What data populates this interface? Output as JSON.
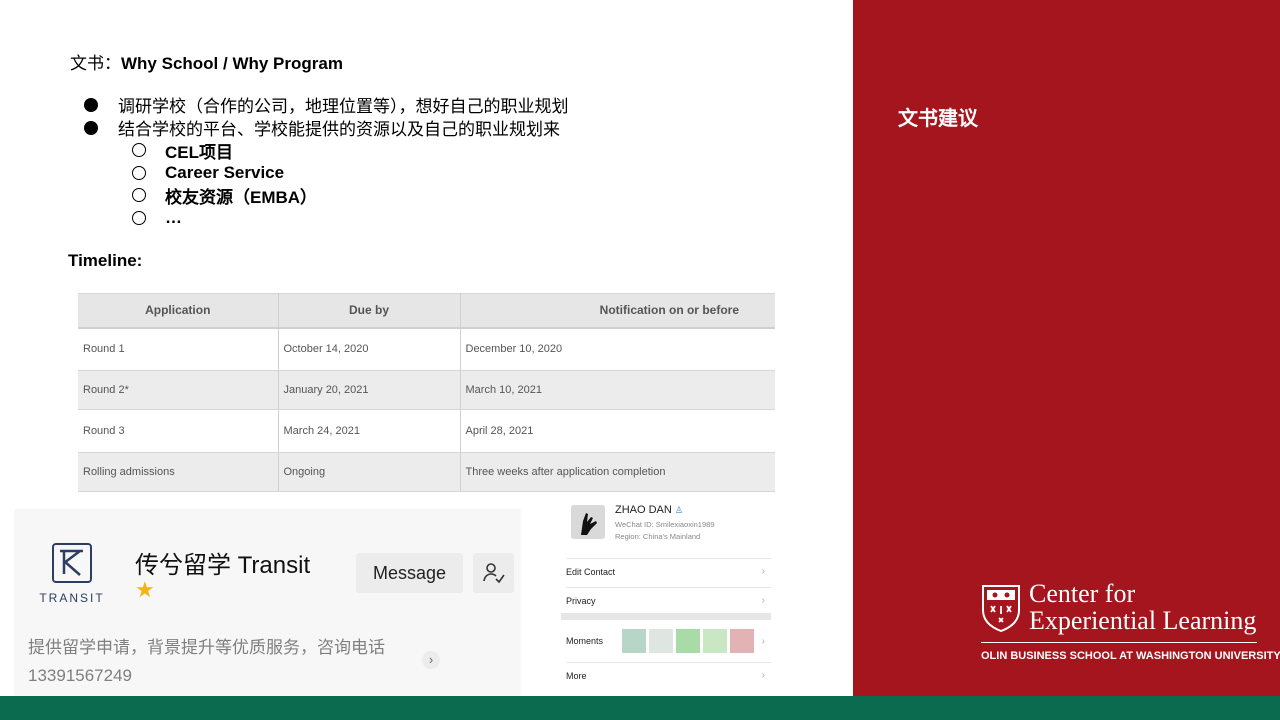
{
  "panel": {
    "title": "文书建议"
  },
  "heading": {
    "prefix": "文书：",
    "text": "Why School / Why Program"
  },
  "bullets": [
    {
      "text": "调研学校（合作的公司，地理位置等），想好自己的职业规划"
    },
    {
      "text": "结合学校的平台、学校能提供的资源以及自己的职业规划来"
    }
  ],
  "sub_bullets": [
    {
      "text": "CEL项目"
    },
    {
      "text": "Career Service"
    },
    {
      "text": "校友资源（EMBA）"
    },
    {
      "text": "…"
    }
  ],
  "timeline": {
    "label": "Timeline:",
    "headers": [
      "Application",
      "Due by",
      "Notification on or before"
    ],
    "rows": [
      [
        "Round 1",
        "October 14, 2020",
        "December 10, 2020"
      ],
      [
        "Round 2*",
        "January 20, 2021",
        "March 10, 2021"
      ],
      [
        "Round 3",
        "March 24, 2021",
        "April 28, 2021"
      ],
      [
        "Rolling admissions",
        "Ongoing",
        "Three weeks after application completion"
      ]
    ]
  },
  "official_account": {
    "logo_text": "TRANSIT",
    "name": "传兮留学 Transit",
    "message_button": "Message",
    "description_line1": "提供留学申请，背景提升等优质服务，咨询电话",
    "description_line2": "13391567249"
  },
  "profile": {
    "name": "ZHAO DAN",
    "wechat_id": "WeChat ID: Smilexiaoxin1989",
    "region": "Region: China's Mainland",
    "rows": [
      "Edit Contact",
      "Privacy",
      "Moments",
      "More"
    ]
  },
  "cel_logo": {
    "line1": "Center for",
    "line2": "Experiential Learning",
    "subtitle": "OLIN BUSINESS SCHOOL AT WASHINGTON UNIVERSITY"
  },
  "colors": {
    "panel": "#a5151d",
    "bottom_bar": "#0b6b4e",
    "star": "#f2b418"
  },
  "icons": [
    "transit-logo-icon",
    "star-icon",
    "follow-user-icon",
    "chevron-right-icon",
    "avatar-hand-icon",
    "verified-icon",
    "shield-icon"
  ]
}
